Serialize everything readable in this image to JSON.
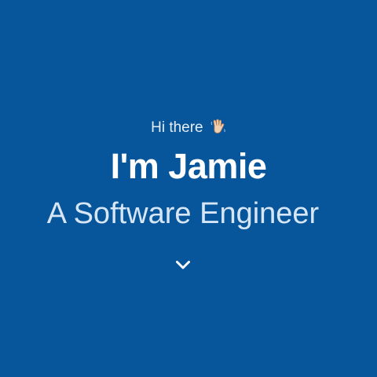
{
  "theme": {
    "background": "#07569b",
    "text_primary": "#ffffff",
    "text_secondary": "#d7e6f5"
  },
  "hero": {
    "greeting": "Hi there",
    "greeting_icon": "waving-hand-icon",
    "name": "I'm Jamie",
    "role": "A Software Engineer",
    "scroll_icon": "chevron-down-icon"
  }
}
